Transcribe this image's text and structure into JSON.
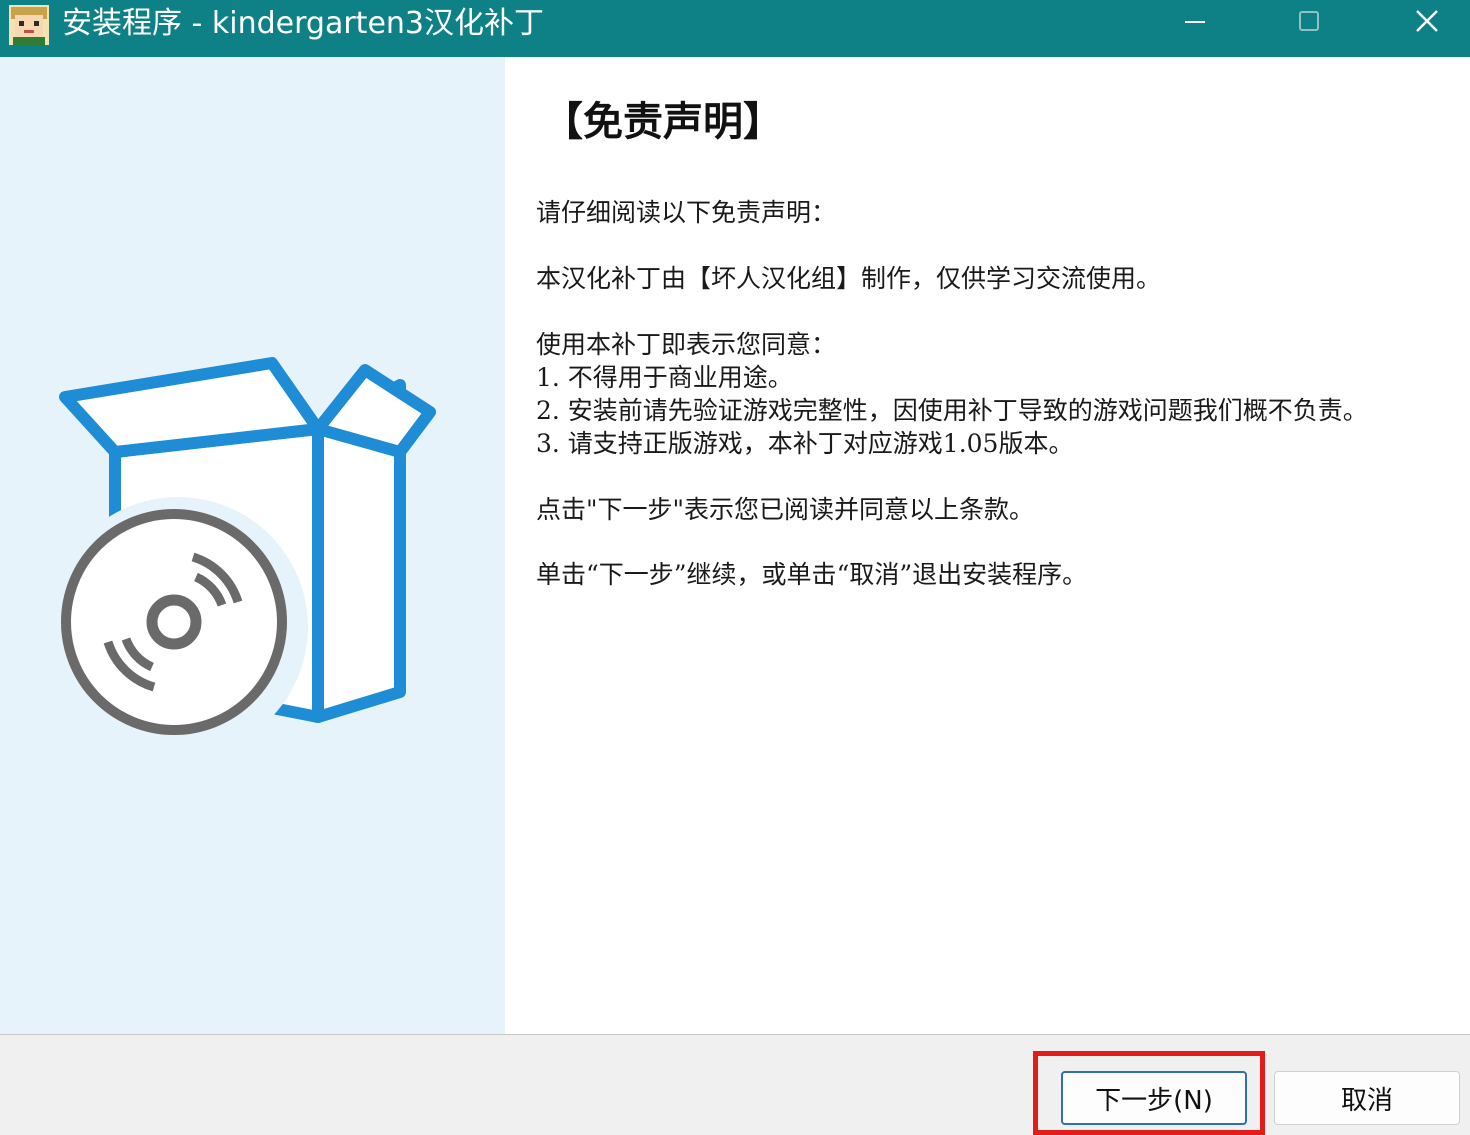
{
  "window": {
    "title": "安装程序 - kindergarten3汉化补丁",
    "icons": {
      "app": "app-icon",
      "minimize": "minimize-icon",
      "maximize": "maximize-icon",
      "close": "close-icon"
    },
    "title_bar_color": "#0d8186"
  },
  "banner": {
    "illustration": "software-box-with-disc-icon",
    "colors": {
      "background": "#e7f3fa",
      "box_outline": "#1f8dd6",
      "disc": "#6a6a6a"
    }
  },
  "content": {
    "heading": "【免责声明】",
    "intro": "请仔细阅读以下免责声明：",
    "credit": "本汉化补丁由【坏人汉化组】制作，仅供学习交流使用。",
    "agree_intro": "使用本补丁即表示您同意：",
    "terms": [
      "1. 不得用于商业用途。",
      "2. 安装前请先验证游戏完整性，因使用补丁导致的游戏问题我们概不负责。",
      "3. 请支持正版游戏，本补丁对应游戏1.05版本。"
    ],
    "click_next": "点击\"下一步\"表示您已阅读并同意以上条款。",
    "instruction": "单击“下一步”继续，或单击“取消”退出安装程序。"
  },
  "footer": {
    "next_label": "下一步(N)",
    "cancel_label": "取消",
    "highlight_color": "#e21b1b"
  }
}
